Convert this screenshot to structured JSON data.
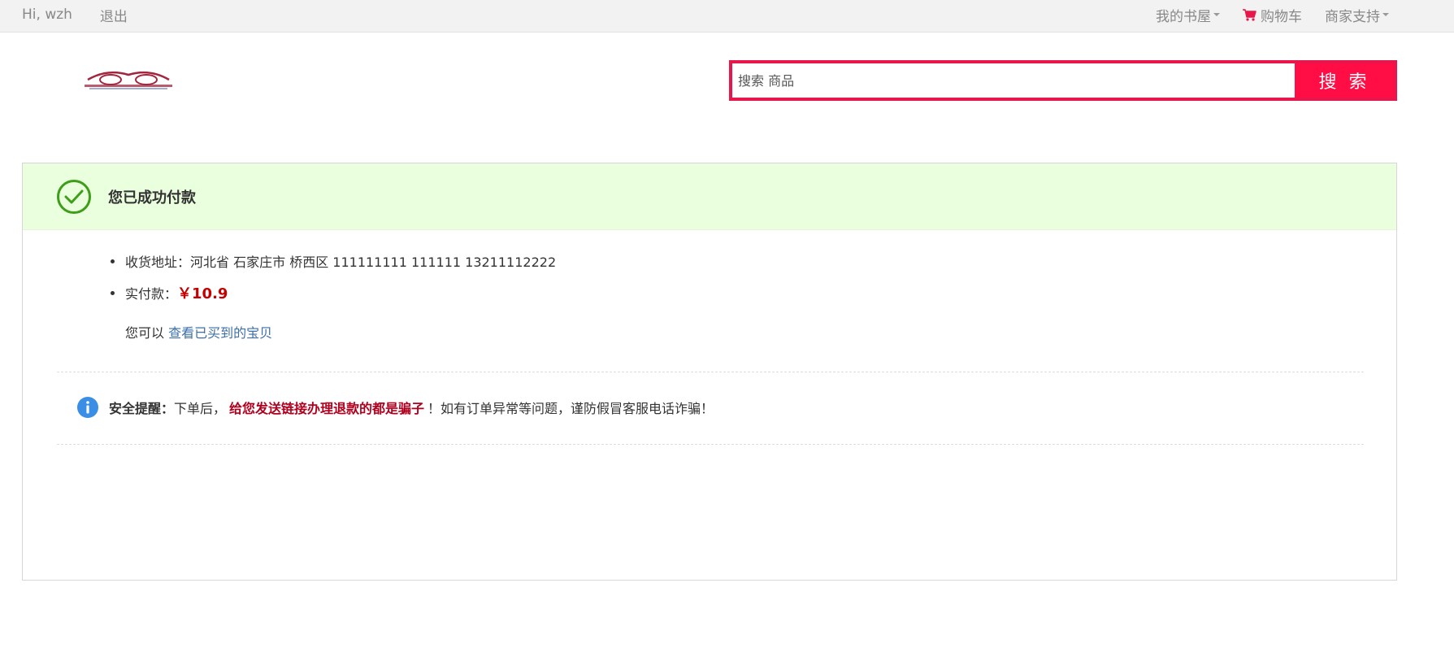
{
  "topbar": {
    "greeting": "Hi,  wzh",
    "logout_label": "退出",
    "nav": [
      {
        "label": "我的书屋",
        "has_dropdown": true
      },
      {
        "label": "购物车",
        "icon": "cart-icon",
        "icon_color": "#e8164a"
      },
      {
        "label": "商家支持",
        "has_dropdown": true
      }
    ]
  },
  "search": {
    "placeholder": "搜索 商品",
    "button_label": "搜 索",
    "border_color": "#e8164a",
    "button_color": "#ff0d44"
  },
  "result": {
    "title": "您已成功付款",
    "status_icon": "check-circle-icon",
    "header_bg": "#eaffdd",
    "address_label": "收货地址：",
    "address_value": "河北省 石家庄市 桥西区 111111111 111111 13211112222",
    "paid_label": "实付款：",
    "paid_amount": "￥10.9",
    "view_prefix": "您可以",
    "view_link": "查看已买到的宝贝"
  },
  "notice": {
    "icon": "info-icon",
    "label": "安全提醒：",
    "text_before": "下单后，",
    "warning": "给您发送链接办理退款的都是骗子",
    "text_after": "！如有订单异常等问题，谨防假冒客服电话诈骗！"
  }
}
